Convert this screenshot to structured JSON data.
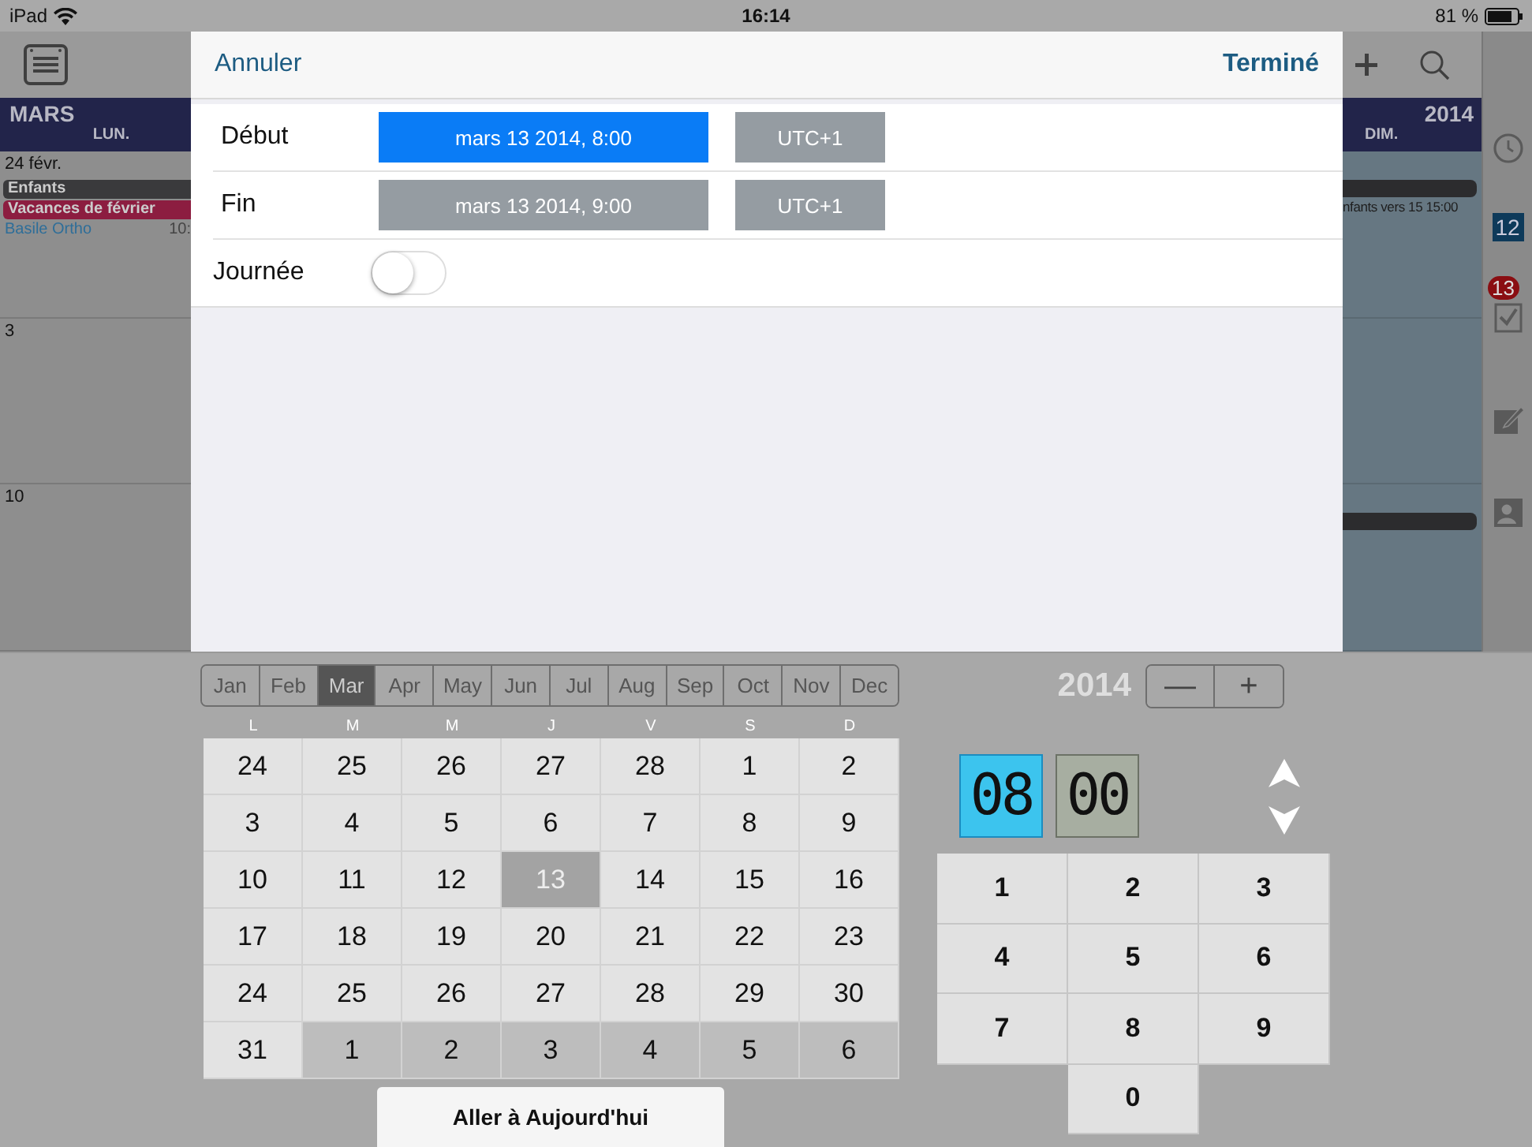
{
  "status_bar": {
    "device": "iPad",
    "time": "16:14",
    "battery": "81 %"
  },
  "background_calendar": {
    "month": "MARS",
    "first_weekday": "LUN.",
    "year": "2014",
    "last_weekday": "DIM.",
    "left_days": [
      {
        "date": "24 févr.",
        "events": [
          {
            "kind": "bar",
            "title": "Enfants",
            "color": "#3a3a3c"
          },
          {
            "kind": "bar",
            "title": "Vacances de février",
            "color": "#8c1d40"
          },
          {
            "kind": "text",
            "title": "Basile Ortho",
            "time": "10:"
          }
        ]
      },
      {
        "date": "3"
      },
      {
        "date": "10"
      }
    ],
    "right_days": [
      {
        "bar": true,
        "title": "nfants vers 15 15:00"
      },
      {
        "bar": false
      },
      {
        "bar": true
      }
    ],
    "sidebar": {
      "calendar_day": "12",
      "tasks_badge": "13"
    }
  },
  "dialog": {
    "cancel": "Annuler",
    "done": "Terminé",
    "rows": [
      {
        "label": "Début",
        "date": "mars 13 2014, 8:00",
        "selected": true,
        "timezone": "UTC+1"
      },
      {
        "label": "Fin",
        "date": "mars 13 2014, 9:00",
        "selected": false,
        "timezone": "UTC+1"
      }
    ],
    "all_day": {
      "label": "Journée",
      "on": false
    }
  },
  "picker": {
    "months": [
      {
        "label": "Jan",
        "selected": false
      },
      {
        "label": "Feb",
        "selected": false
      },
      {
        "label": "Mar",
        "selected": true
      },
      {
        "label": "Apr",
        "selected": false
      },
      {
        "label": "May",
        "selected": false
      },
      {
        "label": "Jun",
        "selected": false
      },
      {
        "label": "Jul",
        "selected": false
      },
      {
        "label": "Aug",
        "selected": false
      },
      {
        "label": "Sep",
        "selected": false
      },
      {
        "label": "Oct",
        "selected": false
      },
      {
        "label": "Nov",
        "selected": false
      },
      {
        "label": "Dec",
        "selected": false
      }
    ],
    "year": "2014",
    "year_minus": "—",
    "year_plus": "+",
    "weekdays": [
      "L",
      "M",
      "M",
      "J",
      "V",
      "S",
      "D"
    ],
    "days": [
      {
        "label": "24",
        "selected": false,
        "shaded": false
      },
      {
        "label": "25",
        "selected": false,
        "shaded": false
      },
      {
        "label": "26",
        "selected": false,
        "shaded": false
      },
      {
        "label": "27",
        "selected": false,
        "shaded": false
      },
      {
        "label": "28",
        "selected": false,
        "shaded": false
      },
      {
        "label": "1",
        "selected": false,
        "shaded": false
      },
      {
        "label": "2",
        "selected": false,
        "shaded": false
      },
      {
        "label": "3",
        "selected": false,
        "shaded": false
      },
      {
        "label": "4",
        "selected": false,
        "shaded": false
      },
      {
        "label": "5",
        "selected": false,
        "shaded": false
      },
      {
        "label": "6",
        "selected": false,
        "shaded": false
      },
      {
        "label": "7",
        "selected": false,
        "shaded": false
      },
      {
        "label": "8",
        "selected": false,
        "shaded": false
      },
      {
        "label": "9",
        "selected": false,
        "shaded": false
      },
      {
        "label": "10",
        "selected": false,
        "shaded": false
      },
      {
        "label": "11",
        "selected": false,
        "shaded": false
      },
      {
        "label": "12",
        "selected": false,
        "shaded": false
      },
      {
        "label": "13",
        "selected": true,
        "shaded": false
      },
      {
        "label": "14",
        "selected": false,
        "shaded": false
      },
      {
        "label": "15",
        "selected": false,
        "shaded": false
      },
      {
        "label": "16",
        "selected": false,
        "shaded": false
      },
      {
        "label": "17",
        "selected": false,
        "shaded": false
      },
      {
        "label": "18",
        "selected": false,
        "shaded": false
      },
      {
        "label": "19",
        "selected": false,
        "shaded": false
      },
      {
        "label": "20",
        "selected": false,
        "shaded": false
      },
      {
        "label": "21",
        "selected": false,
        "shaded": false
      },
      {
        "label": "22",
        "selected": false,
        "shaded": false
      },
      {
        "label": "23",
        "selected": false,
        "shaded": false
      },
      {
        "label": "24",
        "selected": false,
        "shaded": false
      },
      {
        "label": "25",
        "selected": false,
        "shaded": false
      },
      {
        "label": "26",
        "selected": false,
        "shaded": false
      },
      {
        "label": "27",
        "selected": false,
        "shaded": false
      },
      {
        "label": "28",
        "selected": false,
        "shaded": false
      },
      {
        "label": "29",
        "selected": false,
        "shaded": false
      },
      {
        "label": "30",
        "selected": false,
        "shaded": false
      },
      {
        "label": "31",
        "selected": false,
        "shaded": false
      },
      {
        "label": "1",
        "selected": false,
        "shaded": true
      },
      {
        "label": "2",
        "selected": false,
        "shaded": true
      },
      {
        "label": "3",
        "selected": false,
        "shaded": true
      },
      {
        "label": "4",
        "selected": false,
        "shaded": true
      },
      {
        "label": "5",
        "selected": false,
        "shaded": true
      },
      {
        "label": "6",
        "selected": false,
        "shaded": true
      }
    ],
    "today_button": "Aller à Aujourd'hui",
    "time": [
      {
        "value": "08",
        "selected": true
      },
      {
        "value": "00",
        "selected": false
      }
    ],
    "keys": [
      "1",
      "2",
      "3",
      "4",
      "5",
      "6",
      "7",
      "8",
      "9",
      "0"
    ]
  }
}
